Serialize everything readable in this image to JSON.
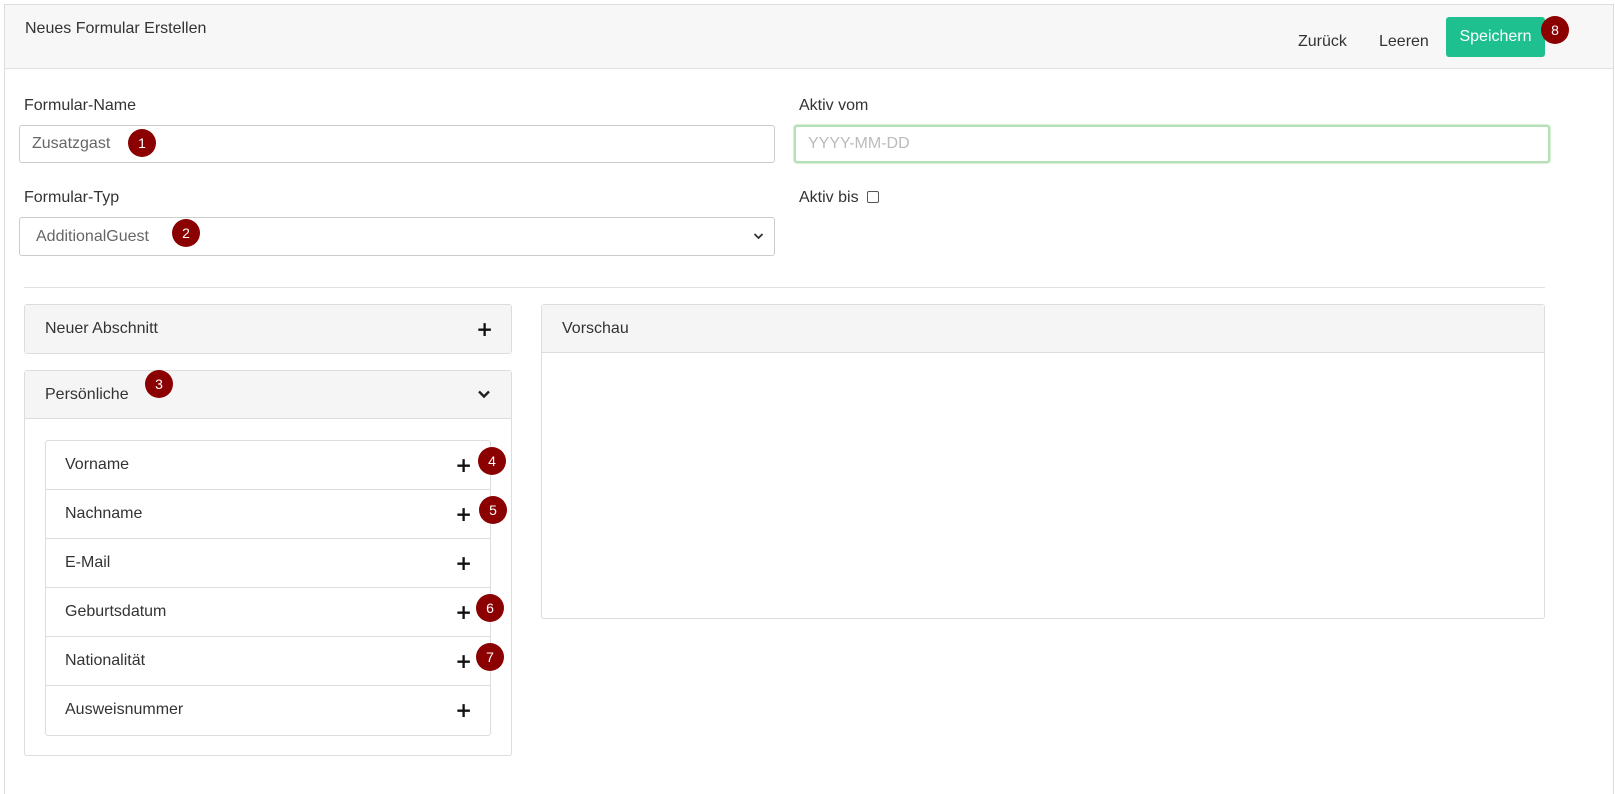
{
  "header": {
    "title": "Neues Formular Erstellen",
    "back_label": "Zurück",
    "clear_label": "Leeren",
    "save_label": "Speichern"
  },
  "form": {
    "name_label": "Formular-Name",
    "name_value": "Zusatzgast",
    "type_label": "Formular-Typ",
    "type_value": "AdditionalGuest",
    "active_from_label": "Aktiv vom",
    "active_from_placeholder": "YYYY-MM-DD",
    "active_until_label": "Aktiv bis"
  },
  "sections": {
    "new_section_label": "Neuer Abschnitt",
    "personal_label": "Persönliche",
    "fields": [
      {
        "label": "Vorname"
      },
      {
        "label": "Nachname"
      },
      {
        "label": "E-Mail"
      },
      {
        "label": "Geburtsdatum"
      },
      {
        "label": "Nationalität"
      },
      {
        "label": "Ausweisnummer"
      }
    ]
  },
  "preview": {
    "title": "Vorschau"
  },
  "badges": [
    "1",
    "2",
    "3",
    "4",
    "5",
    "6",
    "7",
    "8"
  ],
  "colors": {
    "accent": "#1fc08f",
    "badge": "#8b0000"
  }
}
